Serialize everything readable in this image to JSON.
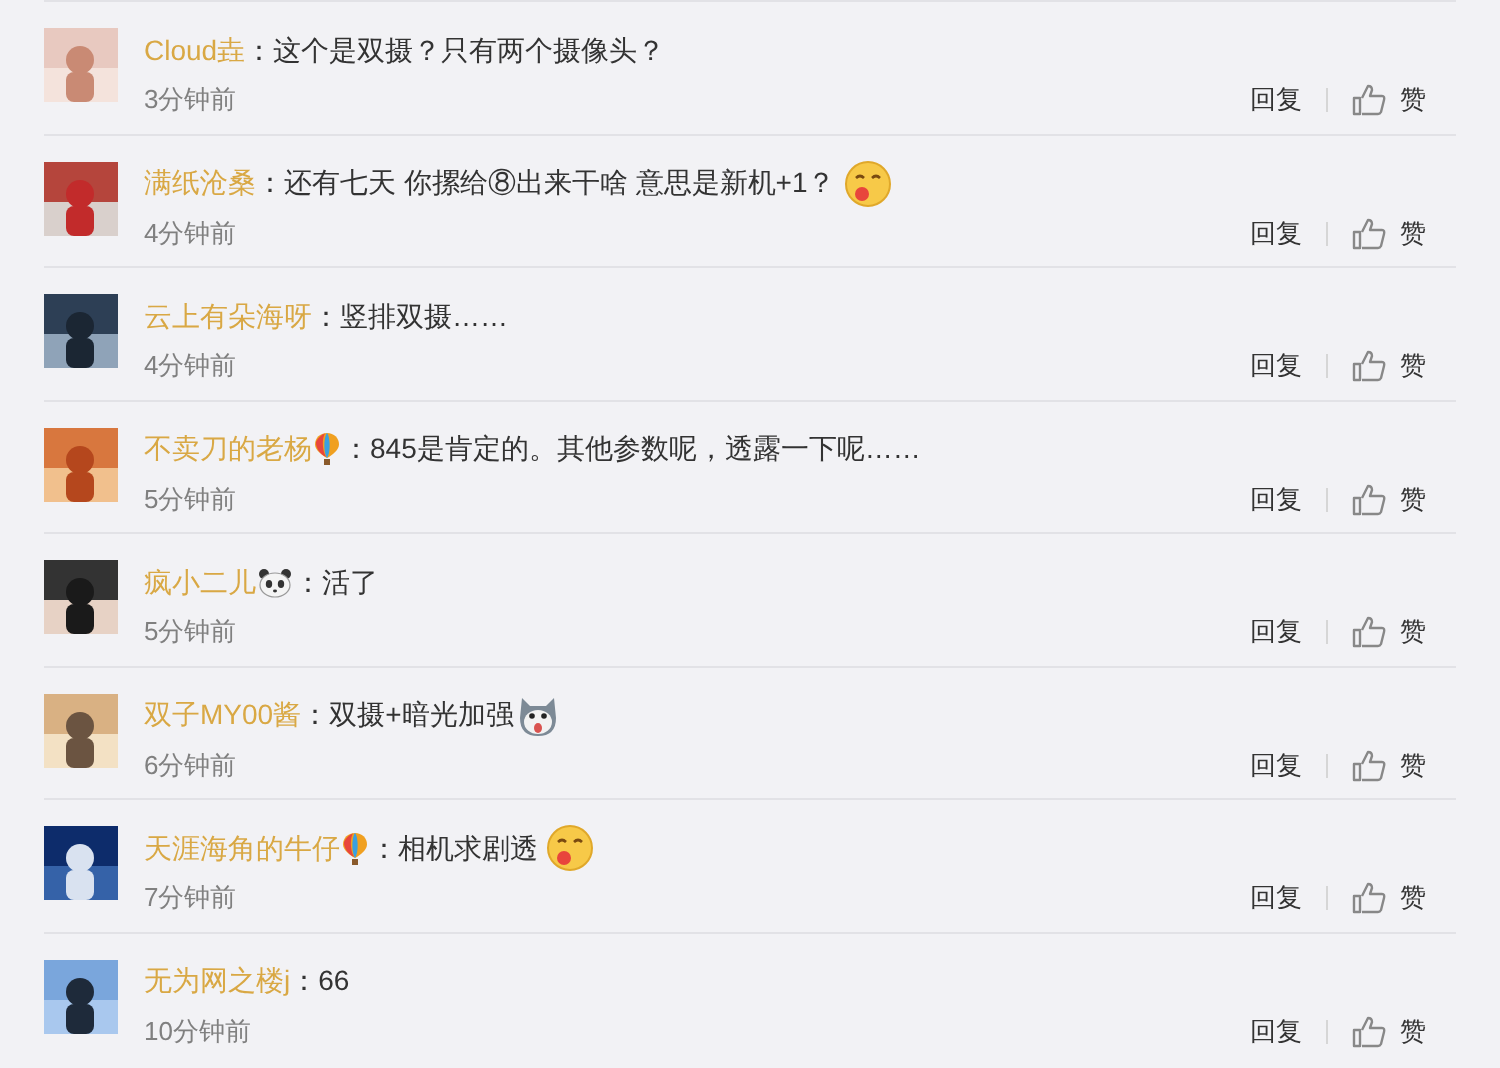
{
  "comments": [
    {
      "name": "Cloud垚",
      "text": "：这个是双摄？只有两个摄像头？",
      "time": "3分钟前",
      "reply": "回复",
      "like": "赞"
    },
    {
      "name": "满纸沧桑",
      "text": "：还有七天 你摞给⑧出来干啥 意思是新机+1？",
      "emoji": {
        "kind": "yum"
      },
      "time": "4分钟前",
      "reply": "回复",
      "like": "赞"
    },
    {
      "name": "云上有朵海呀",
      "text": "：竖排双摄……",
      "time": "4分钟前",
      "reply": "回复",
      "like": "赞"
    },
    {
      "name": "不卖刀的老杨",
      "badge": {
        "kind": "balloon"
      },
      "text": "：845是肯定的。其他参数呢，透露一下呢……",
      "time": "5分钟前",
      "reply": "回复",
      "like": "赞"
    },
    {
      "name": "疯小二儿",
      "badge": {
        "kind": "panda"
      },
      "text": "：活了",
      "time": "5分钟前",
      "reply": "回复",
      "like": "赞"
    },
    {
      "name": "双子MY00酱",
      "text": "：双摄+暗光加强",
      "emoji": {
        "kind": "husky"
      },
      "time": "6分钟前",
      "reply": "回复",
      "like": "赞"
    },
    {
      "name": "天涯海角的牛仔",
      "badge": {
        "kind": "balloon"
      },
      "text": "：相机求剧透",
      "emoji": {
        "kind": "yum"
      },
      "time": "7分钟前",
      "reply": "回复",
      "like": "赞"
    },
    {
      "name": "无为网之楼j",
      "text": "：66",
      "time": "10分钟前",
      "reply": "回复",
      "like": "赞"
    }
  ]
}
